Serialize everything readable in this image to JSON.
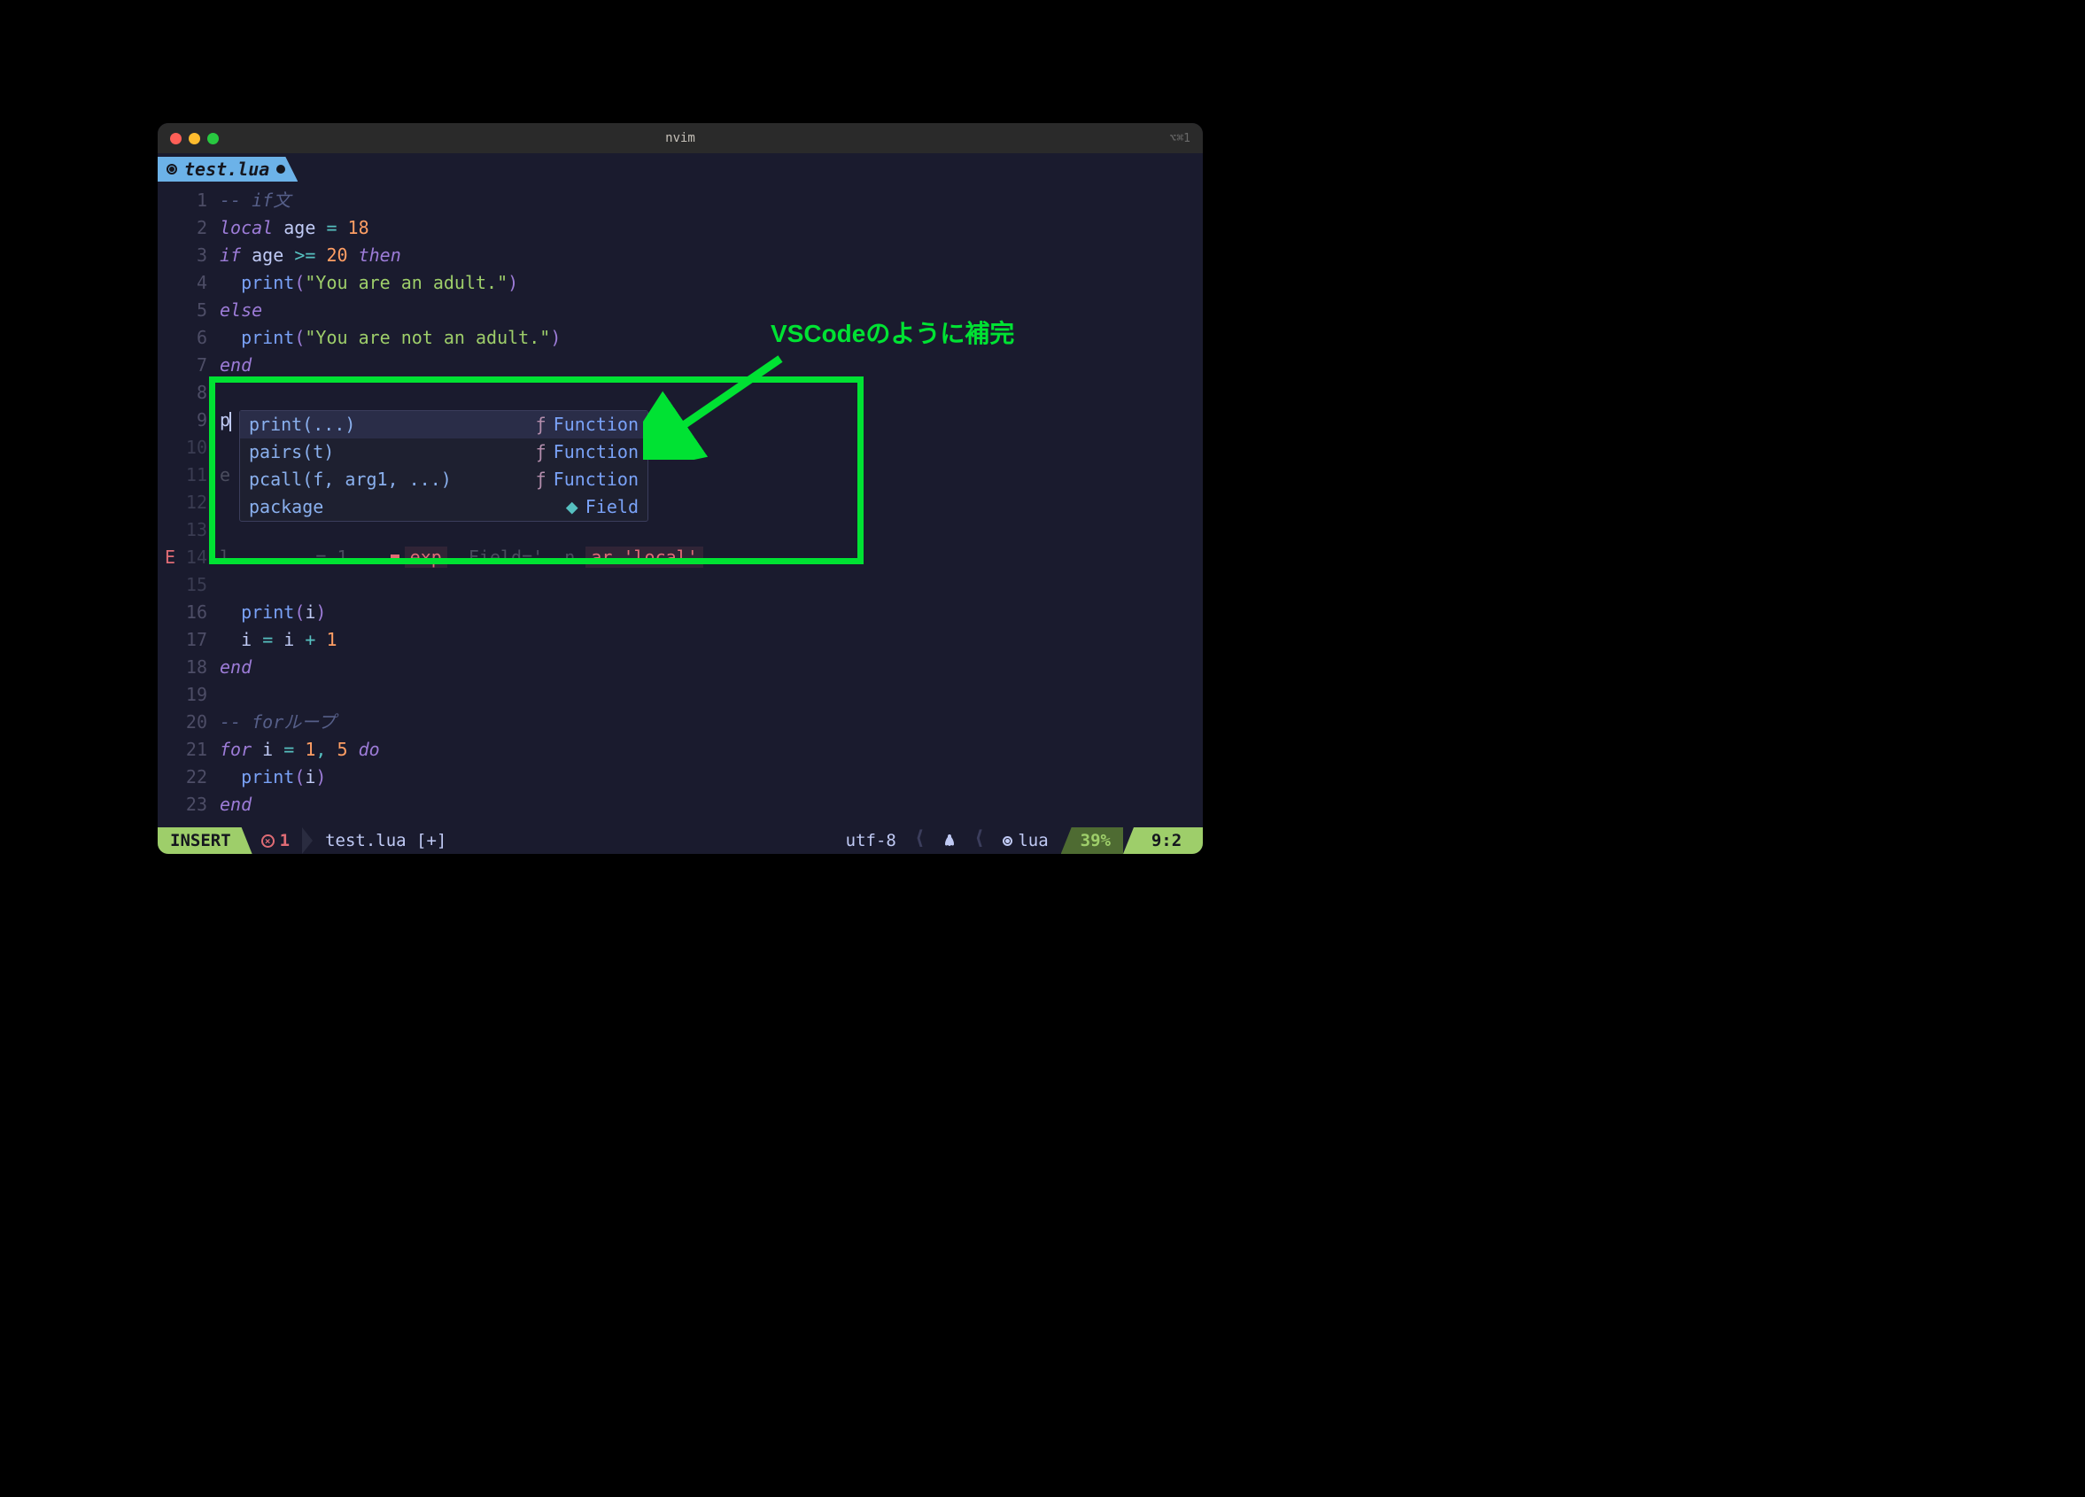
{
  "window": {
    "title": "nvim",
    "shortcut_hint": "⌥⌘1"
  },
  "tab": {
    "filename": "test.lua",
    "modified": true
  },
  "cursor": {
    "line": 9,
    "col": 2,
    "typed": "p"
  },
  "diagnostic": {
    "sign": "E",
    "line": 14,
    "inline_fragment_mid": "exp",
    "inline_fragment_right": "ar 'local'"
  },
  "code_lines": [
    {
      "n": 1,
      "tokens": [
        [
          "comment",
          "-- if文"
        ]
      ]
    },
    {
      "n": 2,
      "tokens": [
        [
          "keyword",
          "local"
        ],
        [
          "sp",
          " "
        ],
        [
          "ident",
          "age"
        ],
        [
          "sp",
          " "
        ],
        [
          "op",
          "="
        ],
        [
          "sp",
          " "
        ],
        [
          "num",
          "18"
        ]
      ]
    },
    {
      "n": 3,
      "tokens": [
        [
          "keyword",
          "if"
        ],
        [
          "sp",
          " "
        ],
        [
          "ident",
          "age"
        ],
        [
          "sp",
          " "
        ],
        [
          "op",
          ">="
        ],
        [
          "sp",
          " "
        ],
        [
          "num",
          "20"
        ],
        [
          "sp",
          " "
        ],
        [
          "keyword",
          "then"
        ]
      ]
    },
    {
      "n": 4,
      "tokens": [
        [
          "sp",
          "  "
        ],
        [
          "func",
          "print"
        ],
        [
          "paren",
          "("
        ],
        [
          "str",
          "\"You are an adult.\""
        ],
        [
          "paren",
          ")"
        ]
      ]
    },
    {
      "n": 5,
      "tokens": [
        [
          "keyword",
          "else"
        ]
      ]
    },
    {
      "n": 6,
      "tokens": [
        [
          "sp",
          "  "
        ],
        [
          "func",
          "print"
        ],
        [
          "paren",
          "("
        ],
        [
          "str",
          "\"You are not an adult.\""
        ],
        [
          "paren",
          ")"
        ]
      ]
    },
    {
      "n": 7,
      "tokens": [
        [
          "keyword",
          "end"
        ]
      ]
    },
    {
      "n": 8,
      "tokens": []
    },
    {
      "n": 9,
      "tokens": [
        [
          "ident",
          "p"
        ]
      ],
      "cursor": true
    },
    {
      "n": 10,
      "tokens": [],
      "dim": true
    },
    {
      "n": 11,
      "tokens": [
        [
          "dimmed",
          "e"
        ]
      ],
      "dim": true
    },
    {
      "n": 12,
      "tokens": [],
      "dim": true
    },
    {
      "n": 13,
      "tokens": [],
      "dim": true
    },
    {
      "n": 14,
      "tokens": [
        [
          "dimmed",
          "l"
        ]
      ],
      "dim": true,
      "has_diag": true,
      "diag_mid": "= 1",
      "diag_under": "Field='  n"
    },
    {
      "n": 15,
      "tokens": [],
      "dim": true
    },
    {
      "n": 16,
      "tokens": [
        [
          "sp",
          "  "
        ],
        [
          "func",
          "print"
        ],
        [
          "paren",
          "("
        ],
        [
          "ident",
          "i"
        ],
        [
          "paren",
          ")"
        ]
      ]
    },
    {
      "n": 17,
      "tokens": [
        [
          "sp",
          "  "
        ],
        [
          "ident",
          "i"
        ],
        [
          "sp",
          " "
        ],
        [
          "op",
          "="
        ],
        [
          "sp",
          " "
        ],
        [
          "ident",
          "i"
        ],
        [
          "sp",
          " "
        ],
        [
          "op",
          "+"
        ],
        [
          "sp",
          " "
        ],
        [
          "num",
          "1"
        ]
      ]
    },
    {
      "n": 18,
      "tokens": [
        [
          "keyword",
          "end"
        ]
      ]
    },
    {
      "n": 19,
      "tokens": []
    },
    {
      "n": 20,
      "tokens": [
        [
          "comment",
          "-- forループ"
        ]
      ]
    },
    {
      "n": 21,
      "tokens": [
        [
          "keyword",
          "for"
        ],
        [
          "sp",
          " "
        ],
        [
          "ident",
          "i"
        ],
        [
          "sp",
          " "
        ],
        [
          "op",
          "="
        ],
        [
          "sp",
          " "
        ],
        [
          "num",
          "1"
        ],
        [
          "op",
          ","
        ],
        [
          "sp",
          " "
        ],
        [
          "num",
          "5"
        ],
        [
          "sp",
          " "
        ],
        [
          "keyword",
          "do"
        ]
      ]
    },
    {
      "n": 22,
      "tokens": [
        [
          "sp",
          "  "
        ],
        [
          "func",
          "print"
        ],
        [
          "paren",
          "("
        ],
        [
          "ident",
          "i"
        ],
        [
          "paren",
          ")"
        ]
      ]
    },
    {
      "n": 23,
      "tokens": [
        [
          "keyword",
          "end"
        ]
      ]
    }
  ],
  "completion": {
    "items": [
      {
        "label": "print(...)",
        "kind": "Function",
        "kind_icon": "ƒ",
        "selected": true
      },
      {
        "label": "pairs(t)",
        "kind": "Function",
        "kind_icon": "ƒ"
      },
      {
        "label": "pcall(f, arg1, ...)",
        "kind": "Function",
        "kind_icon": "ƒ"
      },
      {
        "label": "package",
        "kind": "Field",
        "kind_icon": "⬥"
      }
    ]
  },
  "annotation": {
    "text": "VSCodeのように補完"
  },
  "statusline": {
    "mode": "INSERT",
    "diag_count": "1",
    "filename": "test.lua [+]",
    "encoding": "utf-8",
    "filetype": "lua",
    "percent": "39%",
    "position": "9:2"
  },
  "colors": {
    "bg": "#1a1b2e",
    "accent_green": "#9ece6a",
    "accent_blue": "#7aa2f7",
    "highlight_box": "#00e233"
  }
}
